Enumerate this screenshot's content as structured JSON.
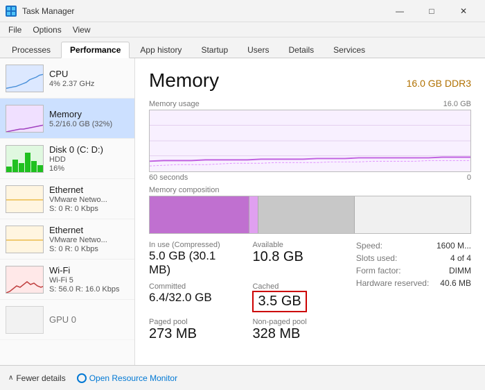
{
  "titlebar": {
    "title": "Task Manager",
    "icon": "TM",
    "minimize": "—",
    "maximize": "□",
    "close": "✕"
  },
  "menubar": {
    "items": [
      "File",
      "Options",
      "View"
    ]
  },
  "tabs": {
    "items": [
      "Processes",
      "Performance",
      "App history",
      "Startup",
      "Users",
      "Details",
      "Services"
    ],
    "active": "Performance"
  },
  "sidebar": {
    "items": [
      {
        "name": "CPU",
        "sub1": "4% 2.37 GHz",
        "sub2": "",
        "type": "cpu",
        "active": false
      },
      {
        "name": "Memory",
        "sub1": "5.2/16.0 GB (32%)",
        "sub2": "",
        "type": "memory",
        "active": true
      },
      {
        "name": "Disk 0 (C: D:)",
        "sub1": "HDD",
        "sub2": "16%",
        "type": "disk",
        "active": false
      },
      {
        "name": "Ethernet",
        "sub1": "VMware Netwo...",
        "sub2": "S: 0 R: 0 Kbps",
        "type": "eth1",
        "active": false
      },
      {
        "name": "Ethernet",
        "sub1": "VMware Netwo...",
        "sub2": "S: 0 R: 0 Kbps",
        "type": "eth2",
        "active": false
      },
      {
        "name": "Wi-Fi",
        "sub1": "Wi-Fi 5",
        "sub2": "S: 56.0 R: 16.0 Kbps",
        "type": "wifi",
        "active": false
      },
      {
        "name": "GPU 0",
        "sub1": "",
        "sub2": "",
        "type": "gpu",
        "active": false
      }
    ]
  },
  "panel": {
    "title": "Memory",
    "subtitle": "16.0 GB DDR3",
    "chart_usage_label": "Memory usage",
    "chart_usage_max": "16.0 GB",
    "chart_usage_time": "60 seconds",
    "chart_usage_zero": "0",
    "chart_composition_label": "Memory composition",
    "stats": {
      "in_use_label": "In use (Compressed)",
      "in_use_value": "5.0 GB (30.1 MB)",
      "available_label": "Available",
      "available_value": "10.8 GB",
      "committed_label": "Committed",
      "committed_value": "6.4/32.0 GB",
      "cached_label": "Cached",
      "cached_value": "3.5 GB",
      "paged_pool_label": "Paged pool",
      "paged_pool_value": "273 MB",
      "non_paged_pool_label": "Non-paged pool",
      "non_paged_pool_value": "328 MB"
    },
    "right_stats": {
      "speed_label": "Speed:",
      "speed_value": "1600 M...",
      "slots_label": "Slots used:",
      "slots_value": "4 of 4",
      "form_label": "Form factor:",
      "form_value": "DIMM",
      "hardware_label": "Hardware reserved:",
      "hardware_value": "40.6 MB"
    }
  },
  "bottombar": {
    "fewer_details": "Fewer details",
    "resource_monitor": "Open Resource Monitor"
  }
}
